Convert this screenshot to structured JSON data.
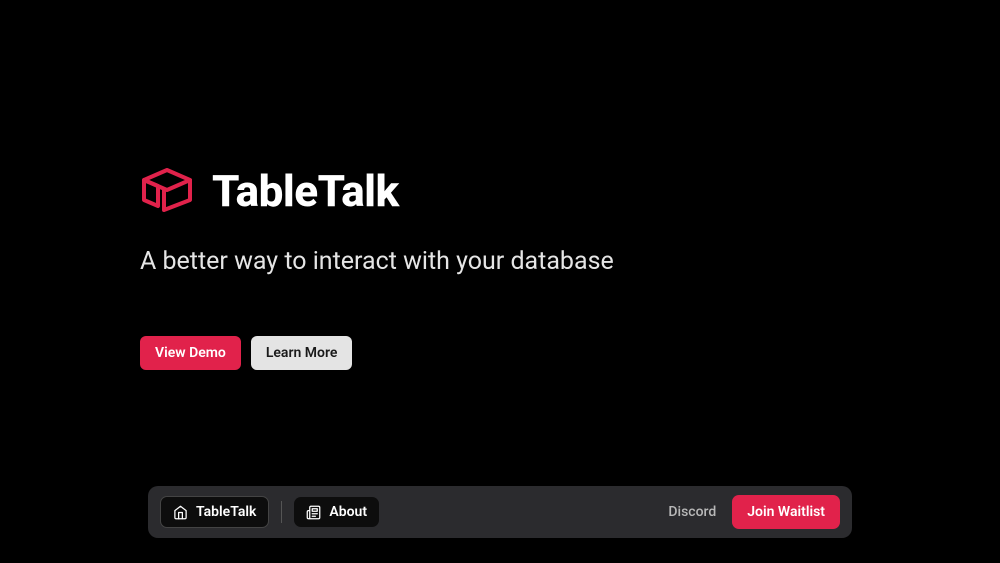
{
  "brand": "TableTalk",
  "tagline": "A better way to interact with your database",
  "cta": {
    "primary": "View Demo",
    "secondary": "Learn More"
  },
  "nav": {
    "home": "TableTalk",
    "about": "About",
    "discord": "Discord",
    "join": "Join Waitlist"
  },
  "colors": {
    "accent": "#e1224b",
    "background": "#000000",
    "navBg": "#2b2b2e"
  }
}
